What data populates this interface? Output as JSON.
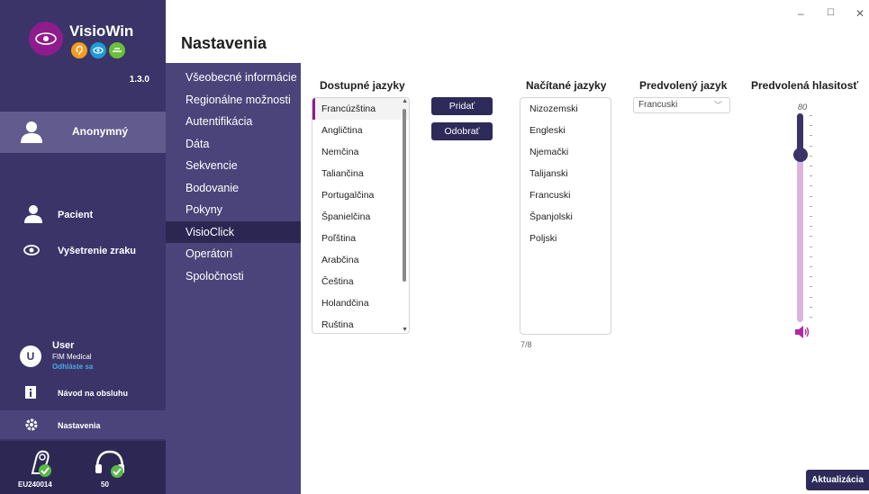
{
  "app": {
    "name": "VisioWin",
    "version": "1.3.0"
  },
  "sidebar": {
    "profile_label": "Anonymný",
    "nav": [
      {
        "label": "Pacient"
      },
      {
        "label": "Vyšetrenie zraku"
      }
    ],
    "user": {
      "initial": "U",
      "name": "User",
      "organization": "FIM Medical",
      "logout_label": "Odhláste sa"
    },
    "manual_label": "Návod na obsluhu",
    "settings_label": "Nastavenia",
    "devices": {
      "first_id": "EU240014",
      "second_id": "50"
    }
  },
  "settings": {
    "title": "Nastavenia",
    "items": [
      {
        "label": "Všeobecné informácie"
      },
      {
        "label": "Regionálne možnosti"
      },
      {
        "label": "Autentifikácia"
      },
      {
        "label": "Dáta"
      },
      {
        "label": "Sekvencie"
      },
      {
        "label": "Bodovanie"
      },
      {
        "label": "Pokyny"
      },
      {
        "label": "VisioClick"
      },
      {
        "label": "Operátori"
      },
      {
        "label": "Spoločnosti"
      }
    ],
    "active_index": 7
  },
  "languages": {
    "available_title": "Dostupné jazyky",
    "available": [
      "Francúzština",
      "Angličtina",
      "Nemčina",
      "Taliančina",
      "Portugalčina",
      "Španielčina",
      "Poľština",
      "Arabčina",
      "Čeština",
      "Holandčina",
      "Ruština"
    ],
    "selected_available": 0,
    "add_button": "Pridať",
    "remove_button": "Odobrať",
    "loaded_title": "Načítané jazyky",
    "loaded": [
      "Nizozemski",
      "Engleski",
      "Njemački",
      "Talijanski",
      "Francuski",
      "Španjolski",
      "Poljski"
    ],
    "loaded_count": "7/8",
    "default_title": "Predvolený jazyk",
    "default_value": "Francuski"
  },
  "volume": {
    "title": "Predvolená hlasitosť",
    "value": "80",
    "level_fraction": 0.8
  },
  "update_button": "Aktualizácia",
  "window_controls": {
    "minimize": "–",
    "maximize": "☐",
    "close": "✕"
  },
  "colors": {
    "sidebar": "#3a3468",
    "accent": "#8e1c8c",
    "button": "#2e2a59"
  }
}
